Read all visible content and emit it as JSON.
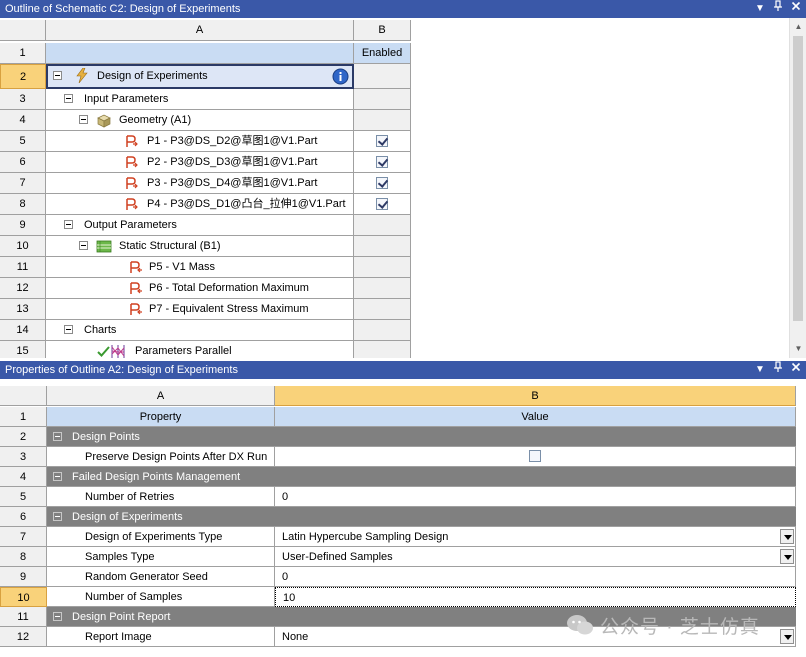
{
  "outline": {
    "title": "Outline of Schematic C2: Design of Experiments",
    "controls": [
      "▼",
      "ᵖ",
      "×"
    ],
    "col_a": "A",
    "col_b": "B",
    "rows": [
      {
        "num": "1",
        "a": "",
        "b": "Enabled"
      },
      {
        "num": "2",
        "a": "Design of Experiments",
        "b": ""
      },
      {
        "num": "3",
        "a": "Input Parameters",
        "b": ""
      },
      {
        "num": "4",
        "a": "Geometry (A1)",
        "b": ""
      },
      {
        "num": "5",
        "a": "P1 - P3@DS_D2@草图1@V1.Part",
        "b": "checked"
      },
      {
        "num": "6",
        "a": "P2 - P3@DS_D3@草图1@V1.Part",
        "b": "checked"
      },
      {
        "num": "7",
        "a": "P3 - P3@DS_D4@草图1@V1.Part",
        "b": "checked"
      },
      {
        "num": "8",
        "a": "P4 - P3@DS_D1@凸台_拉伸1@V1.Part",
        "b": "checked"
      },
      {
        "num": "9",
        "a": "Output Parameters",
        "b": ""
      },
      {
        "num": "10",
        "a": "Static Structural (B1)",
        "b": ""
      },
      {
        "num": "11",
        "a": "P5 - V1 Mass",
        "b": ""
      },
      {
        "num": "12",
        "a": "P6 - Total Deformation Maximum",
        "b": ""
      },
      {
        "num": "13",
        "a": "P7 - Equivalent Stress Maximum",
        "b": ""
      },
      {
        "num": "14",
        "a": "Charts",
        "b": ""
      },
      {
        "num": "15",
        "a": "Parameters Parallel",
        "b": ""
      }
    ]
  },
  "props": {
    "title": "Properties of Outline A2: Design of Experiments",
    "controls": [
      "▼",
      "ᵖ",
      "×"
    ],
    "col_a": "A",
    "col_b": "B",
    "rows": [
      {
        "num": "1",
        "a": "Property",
        "b": "Value"
      },
      {
        "num": "2",
        "a": "Design Points"
      },
      {
        "num": "3",
        "a": "Preserve Design Points After DX Run",
        "b": ""
      },
      {
        "num": "4",
        "a": "Failed Design Points Management"
      },
      {
        "num": "5",
        "a": "Number of Retries",
        "b": "0"
      },
      {
        "num": "6",
        "a": "Design of Experiments"
      },
      {
        "num": "7",
        "a": "Design of Experiments Type",
        "b": "Latin Hypercube Sampling Design"
      },
      {
        "num": "8",
        "a": "Samples Type",
        "b": "User-Defined Samples"
      },
      {
        "num": "9",
        "a": "Random Generator Seed",
        "b": "0"
      },
      {
        "num": "10",
        "a": "Number of Samples",
        "b": "10"
      },
      {
        "num": "11",
        "a": "Design Point Report"
      },
      {
        "num": "12",
        "a": "Report Image",
        "b": "None"
      }
    ]
  },
  "watermark": "公众号 · 芝士仿真"
}
